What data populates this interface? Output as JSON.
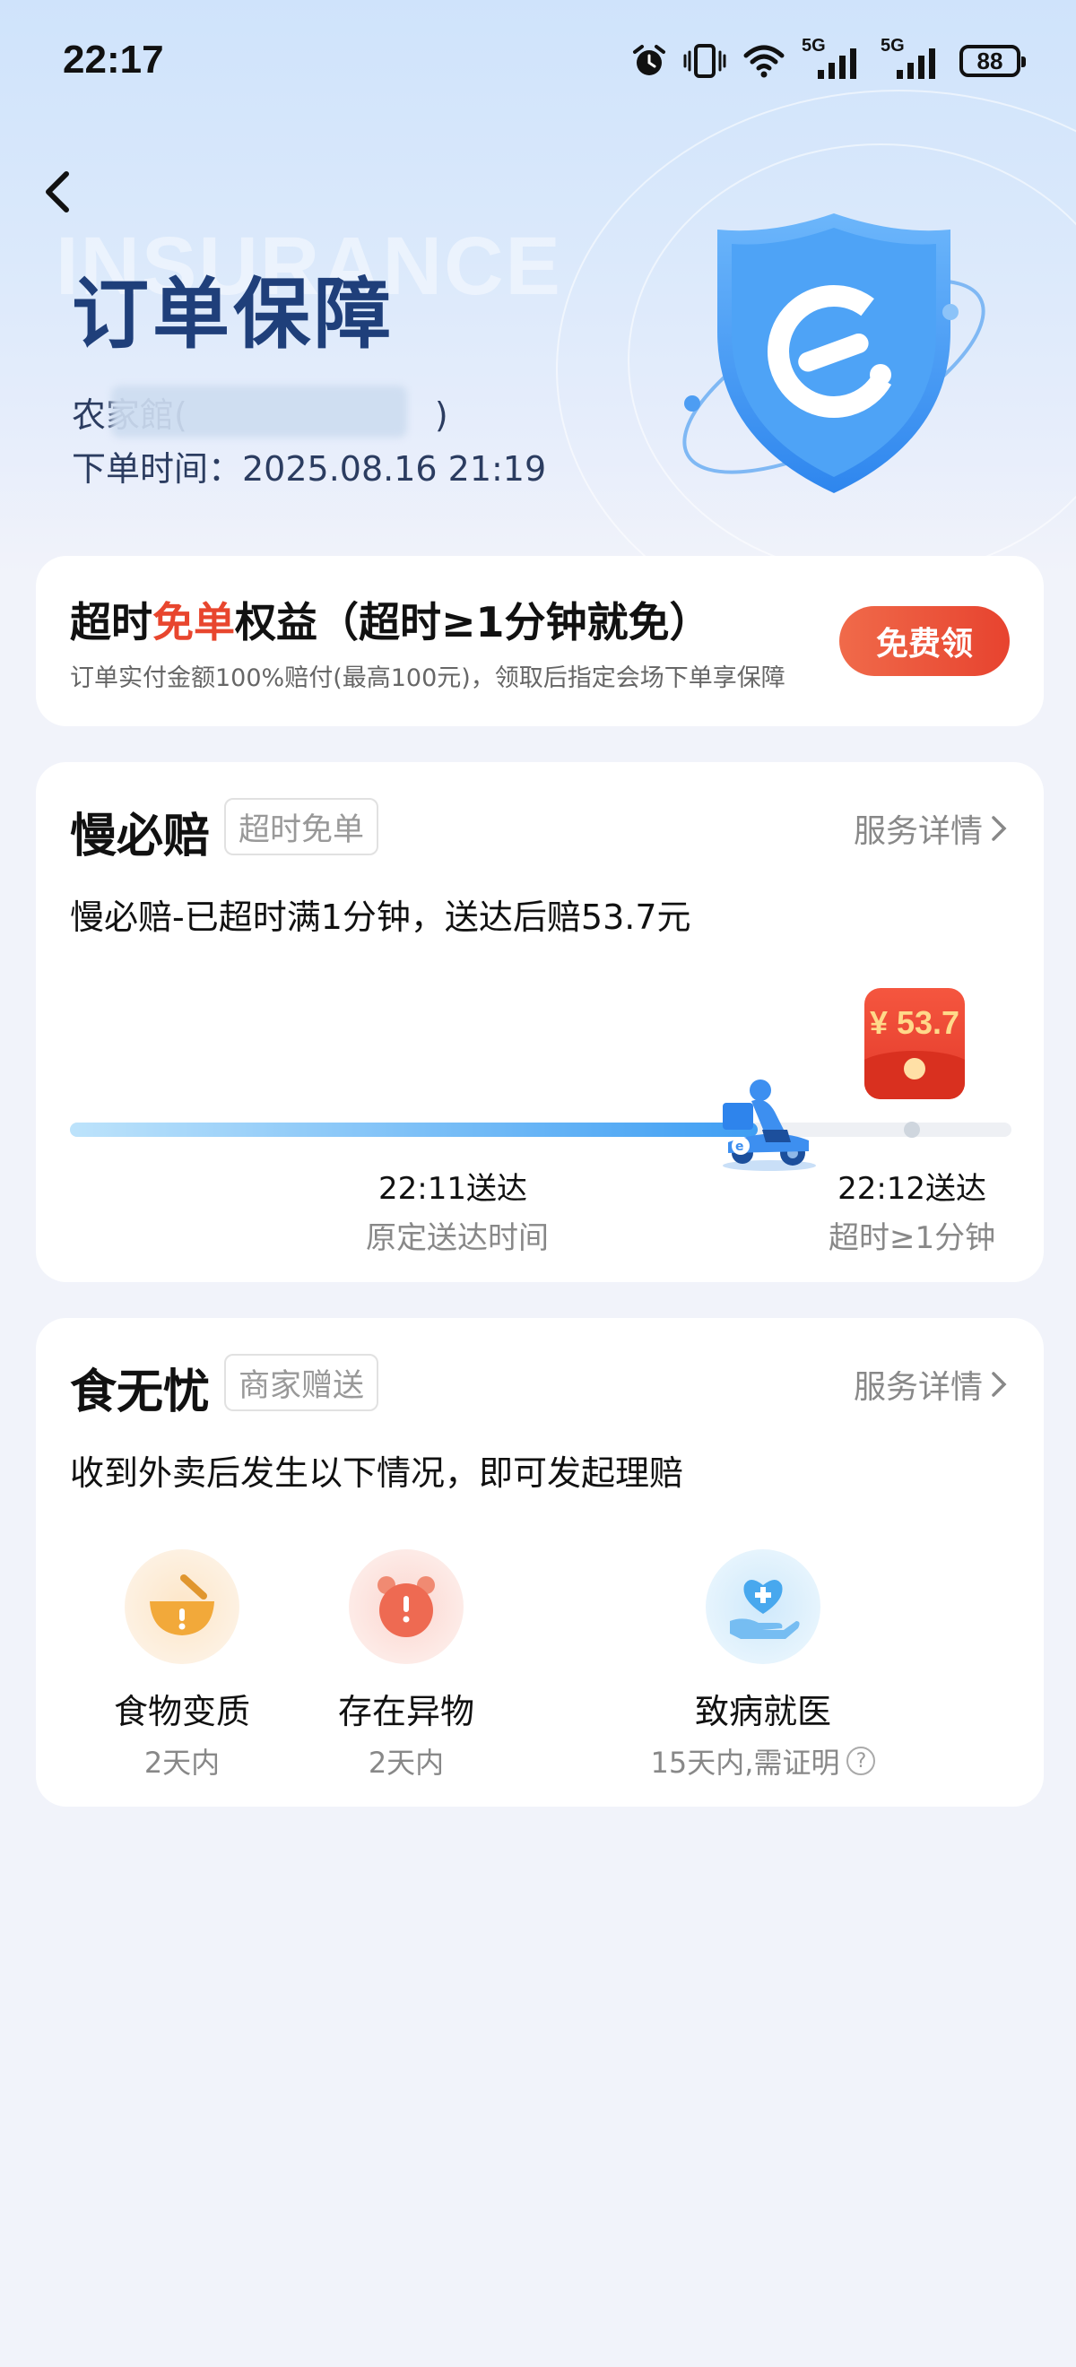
{
  "status_bar": {
    "time": "22:17",
    "network_1": "5G",
    "network_2": "5G",
    "battery": "88"
  },
  "header": {
    "title": "订单保障",
    "watermark": "INSURANCE",
    "shop_name": "农家館(",
    "shop_name_end": ")",
    "order_time": "下单时间：2025.08.16 21:19"
  },
  "overtime_card": {
    "title_pre": "超时",
    "title_highlight": "免单",
    "title_post": "权益（超时≥1分钟就免）",
    "subtitle": "订单实付金额100%赔付(最高100元)，领取后指定会场下单享保障",
    "button": "免费领",
    "accent_color": "#e8462e"
  },
  "slow_compensation": {
    "title": "慢必赔",
    "tag": "超时免单",
    "detail": "服务详情",
    "description": "慢必赔-已超时满1分钟，送达后赔53.7元",
    "red_packet": "¥ 53.7",
    "progress": 0.73,
    "progress_color": "#3e9ef3",
    "timeline": [
      {
        "time": "22:11送达",
        "label": "原定送达时间"
      },
      {
        "time": "22:12送达",
        "label": "超时≥1分钟"
      }
    ]
  },
  "food_worry_free": {
    "title": "食无忧",
    "tag": "商家赠送",
    "detail": "服务详情",
    "description": "收到外卖后发生以下情况，即可发起理赔",
    "items": [
      {
        "name": "食物变质",
        "note": "2天内",
        "icon": "spoiled-bowl-icon"
      },
      {
        "name": "存在异物",
        "note": "2天内",
        "icon": "alarm-icon"
      },
      {
        "name": "致病就医",
        "note": "15天内,需证明",
        "icon": "medical-hand-icon"
      }
    ]
  }
}
